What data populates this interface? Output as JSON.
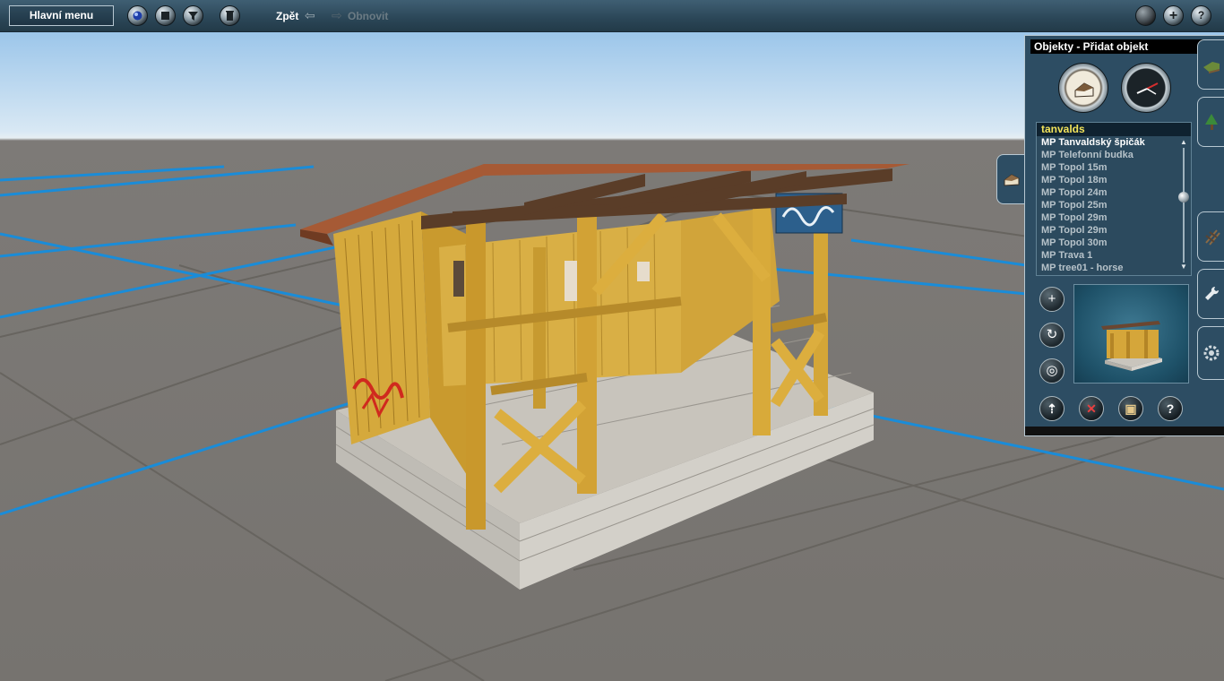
{
  "toolbar": {
    "main_menu_label": "Hlavní menu",
    "back_label": "Zpět",
    "redo_label": "Obnovit",
    "left_icons": [
      "globe-icon",
      "stop-icon",
      "filter-icon",
      "trash-icon"
    ],
    "right_icons": [
      "view-orb-icon",
      "plus-icon",
      "help-icon"
    ],
    "plus_glyph": "+",
    "help_glyph": "?"
  },
  "panel": {
    "title": "Objekty - Přidat objekt",
    "mode_buttons": [
      "house-icon",
      "clock-icon"
    ],
    "list": {
      "header": "tanvalds",
      "items": [
        "MP Tanvaldský špičák",
        "MP Telefonní budka",
        "MP Topol 15m",
        "MP Topol 18m",
        "MP Topol 24m",
        "MP Topol 25m",
        "MP Topol 29m",
        "MP Topol 29m",
        "MP Topol 30m",
        "MP Trava 1",
        "MP tree01 - horse"
      ],
      "selected_index": 0
    },
    "side_buttons": [
      "add-object-icon",
      "rotate-icon",
      "ring-icon"
    ],
    "side_glyphs": [
      "+",
      "↻",
      "◎"
    ],
    "bottom_buttons": [
      "pick-icon",
      "delete-icon",
      "object-properties-icon",
      "help-icon"
    ],
    "bottom_glyphs": [
      "⇡",
      "✕",
      "▣",
      "?"
    ],
    "tabs": [
      "terrain-tab",
      "trackside-tab",
      "track-tab",
      "tools-tab",
      "settings-tab"
    ]
  },
  "colors": {
    "panel_bg": "#2d4d63",
    "list_header_text": "#f2e35a",
    "grid_line": "#1a8cd8",
    "toolbar_bg": "#2b4657"
  }
}
